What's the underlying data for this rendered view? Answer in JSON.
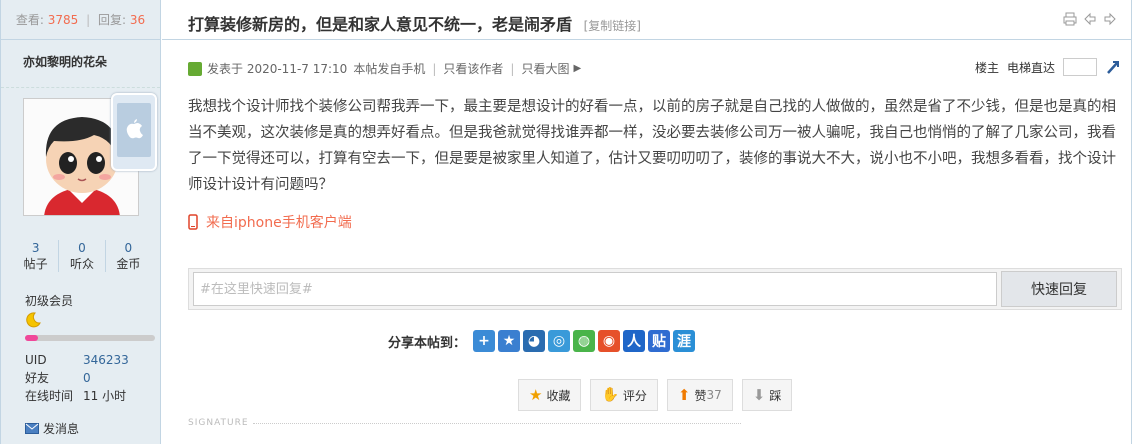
{
  "stats": {
    "views_label": "查看:",
    "views": "3785",
    "replies_label": "回复:",
    "replies": "36"
  },
  "author": {
    "name": "亦如黎明的花朵"
  },
  "counts": [
    {
      "value": "3",
      "label": "帖子"
    },
    {
      "value": "0",
      "label": "听众"
    },
    {
      "value": "0",
      "label": "金币"
    }
  ],
  "rank": {
    "label": "初级会员",
    "progress": 0.1
  },
  "info": {
    "uid_label": "UID",
    "uid": "346233",
    "friends_label": "好友",
    "friends": "0",
    "online_label": "在线时间",
    "online": "11 小时"
  },
  "send_message": "发消息",
  "thread": {
    "title": "打算装修新房的，但是和家人意见不统一，老是闹矛盾",
    "copy_link": "[复制链接]"
  },
  "meta": {
    "posted": "发表于 2020-11-7 17:10",
    "device": "本帖发自手机",
    "only_author": "只看该作者",
    "only_big_pic": "只看大图",
    "floor_owner": "楼主",
    "floor_jump": "电梯直达"
  },
  "content": "我想找个设计师找个装修公司帮我弄一下，最主要是想设计的好看一点，以前的房子就是自己找的人做做的，虽然是省了不少钱，但是也是真的相当不美观，这次装修是真的想弄好看点。但是我爸就觉得找谁弄都一样，没必要去装修公司万一被人骗呢，我自己也悄悄的了解了几家公司，我看了一下觉得还可以，打算有空去一下，但是要是被家里人知道了，估计又要叨叨叨了，装修的事说大不大，说小也不小吧，我想多看看，找个设计师设计设计有问题吗？",
  "client_note": "来自iphone手机客户端",
  "reply": {
    "placeholder": "#在这里快速回复#",
    "button": "快速回复"
  },
  "share_label": "分享本帖到：",
  "share_icons": [
    {
      "name": "plus-share-icon",
      "glyph": "+",
      "color": "#3b8bd6"
    },
    {
      "name": "qzone-star-icon",
      "glyph": "★",
      "color": "#3a7fd0"
    },
    {
      "name": "qq-penguin-icon",
      "glyph": "◕",
      "color": "#2a6cb0"
    },
    {
      "name": "tencent-weibo-icon",
      "glyph": "◎",
      "color": "#3a9ad9"
    },
    {
      "name": "wechat-icon",
      "glyph": "◍",
      "color": "#4ab44a"
    },
    {
      "name": "sina-weibo-icon",
      "glyph": "◉",
      "color": "#e6502a"
    },
    {
      "name": "renren-icon",
      "glyph": "人",
      "color": "#1f66c8"
    },
    {
      "name": "tieba-icon",
      "glyph": "贴",
      "color": "#2f6cd1"
    },
    {
      "name": "douban-icon",
      "glyph": "涯",
      "color": "#2a8fd6"
    }
  ],
  "actions": {
    "favorite": "收藏",
    "rate": "评分",
    "like": "赞",
    "like_count": "37",
    "dislike": "踩"
  },
  "signature": "SIGNATURE"
}
